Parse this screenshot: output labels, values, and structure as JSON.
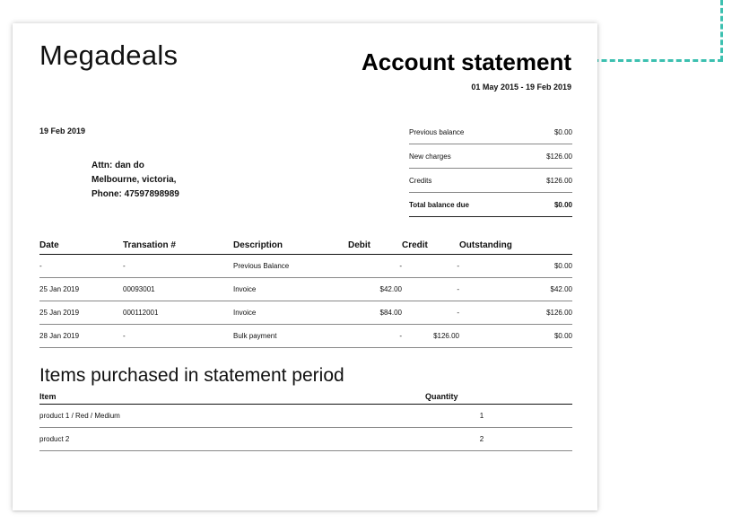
{
  "company": "Megadeals",
  "document": {
    "title": "Account statement",
    "period": "01 May 2015 - 19 Feb 2019",
    "date": "19 Feb 2019"
  },
  "address": {
    "attn": "Attn: dan do",
    "city": "Melbourne, victoria,",
    "phone": "Phone: 47597898989"
  },
  "summary": [
    {
      "label": "Previous balance",
      "value": "$0.00"
    },
    {
      "label": "New charges",
      "value": "$126.00"
    },
    {
      "label": "Credits",
      "value": "$126.00"
    },
    {
      "label": "Total balance due",
      "value": "$0.00"
    }
  ],
  "transactions": {
    "headers": [
      "Date",
      "Transation #",
      "Description",
      "Debit",
      "Credit",
      "Outstanding"
    ],
    "rows": [
      [
        "-",
        "-",
        "Previous Balance",
        "-",
        "-",
        "$0.00"
      ],
      [
        "25 Jan 2019",
        "00093001",
        "Invoice",
        "$42.00",
        "-",
        "$42.00"
      ],
      [
        "25 Jan 2019",
        "000112001",
        "Invoice",
        "$84.00",
        "-",
        "$126.00"
      ],
      [
        "28 Jan 2019",
        "-",
        "Bulk payment",
        "-",
        "$126.00",
        "$0.00"
      ]
    ]
  },
  "items": {
    "title": "Items purchased in statement period",
    "headers": [
      "Item",
      "Quantity"
    ],
    "rows": [
      [
        "product 1 / Red / Medium",
        "1"
      ],
      [
        "product 2",
        "2"
      ]
    ]
  },
  "colors": {
    "connector": "#3cc0b0"
  }
}
